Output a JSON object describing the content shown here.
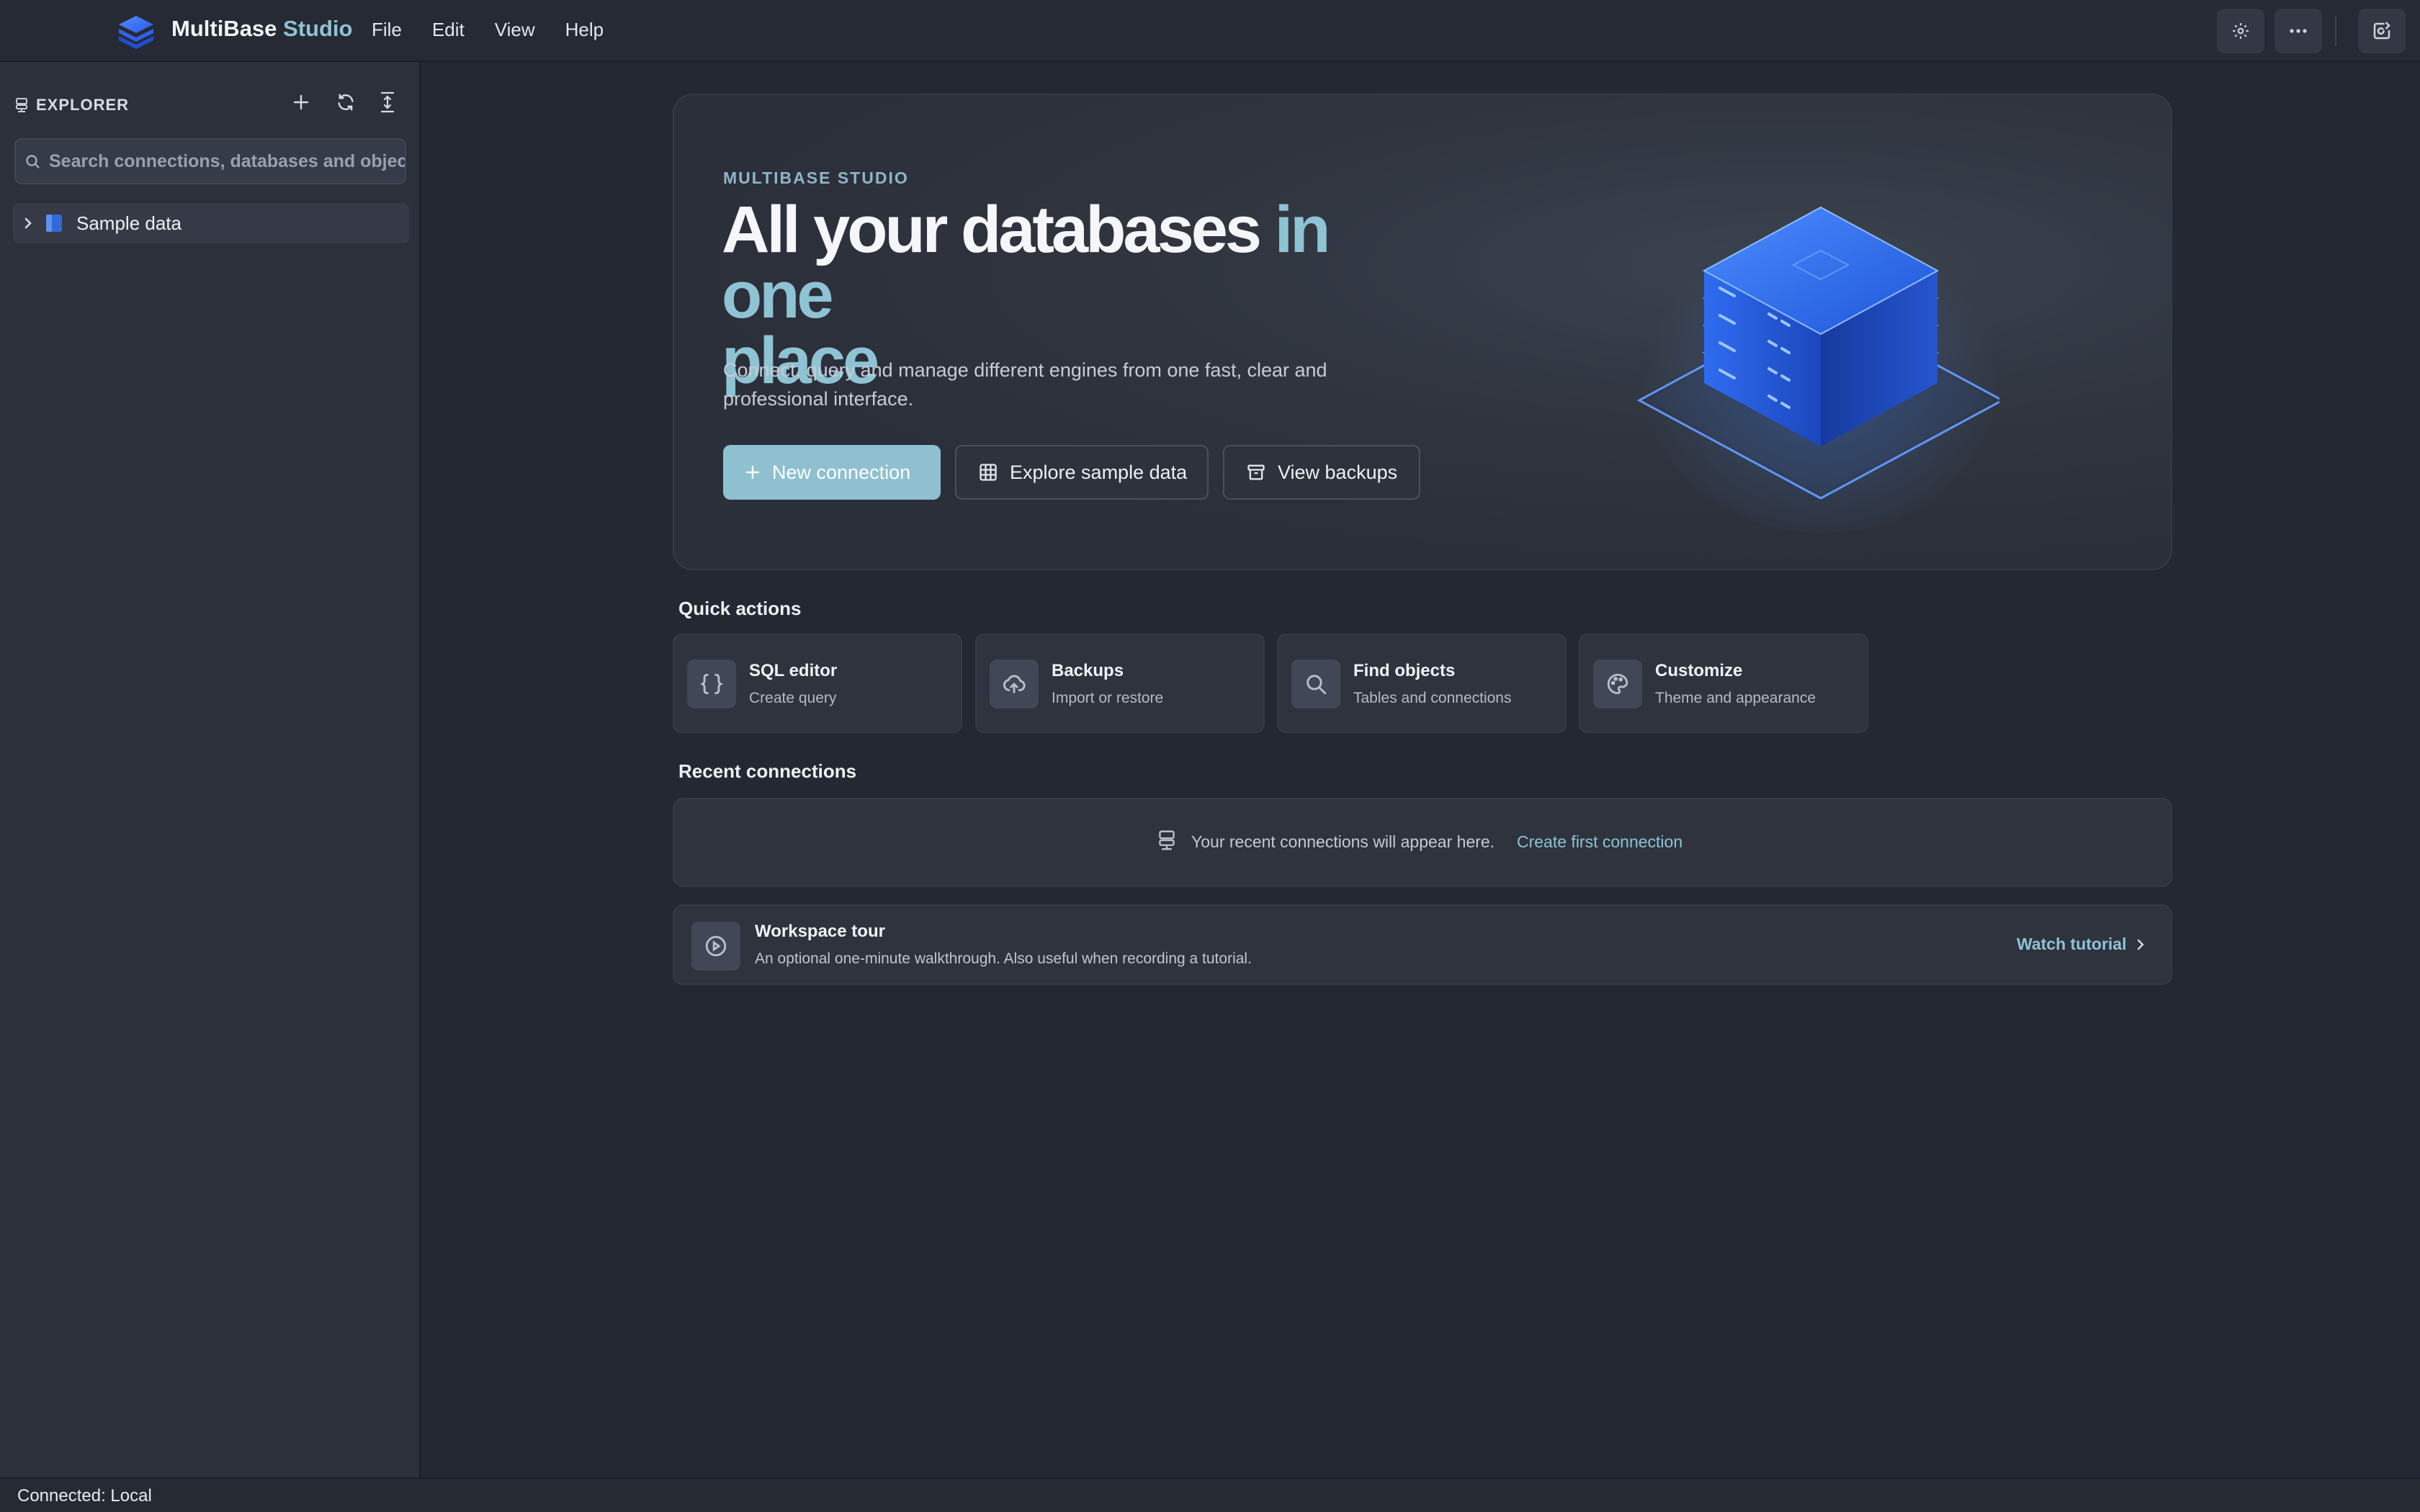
{
  "app": {
    "brand_name": "MultiBase",
    "brand_suffix": "Studio",
    "menu": [
      "File",
      "Edit",
      "View",
      "Help"
    ]
  },
  "titlebar_icons": [
    "gear-icon",
    "more-horizontal-icon",
    "refresh-icon"
  ],
  "sidebar": {
    "title": "EXPLORER",
    "tools": [
      "plus-icon",
      "refresh-icon",
      "collapse-icon"
    ],
    "search_placeholder": "Search connections, databases and objects",
    "tree": [
      {
        "label": "Sample data",
        "expanded": false,
        "icon": "database-icon"
      }
    ]
  },
  "hero": {
    "eyebrow": "MULTIBASE STUDIO",
    "headline_main": "All your databases",
    "headline_accent_1": "in one",
    "headline_accent_2": "place",
    "subtitle": "Connect, query and manage different engines from one fast, clear and professional interface.",
    "buttons": {
      "new_connection": "New connection",
      "explore_sample": "Explore sample data",
      "view_backups": "View backups"
    }
  },
  "quick_actions": {
    "title": "Quick actions",
    "items": [
      {
        "title": "SQL editor",
        "subtitle": "Create query",
        "icon": "braces-icon"
      },
      {
        "title": "Backups",
        "subtitle": "Import or restore",
        "icon": "cloud-upload-icon"
      },
      {
        "title": "Find objects",
        "subtitle": "Tables and connections",
        "icon": "search-icon"
      },
      {
        "title": "Customize",
        "subtitle": "Theme and appearance",
        "icon": "palette-icon"
      }
    ]
  },
  "recent": {
    "title": "Recent connections",
    "empty_text": "Your recent connections will appear here.",
    "link": "Create first connection"
  },
  "tour": {
    "title": "Workspace tour",
    "subtitle": "An optional one-minute walkthrough. Also useful when recording a tutorial.",
    "link": "Watch tutorial"
  },
  "status": {
    "text": "Connected: Local"
  },
  "colors": {
    "accent": "#8ec3d3",
    "primary_button": "#8ec0cf",
    "background": "#242833",
    "sidebar": "#2b303b"
  }
}
